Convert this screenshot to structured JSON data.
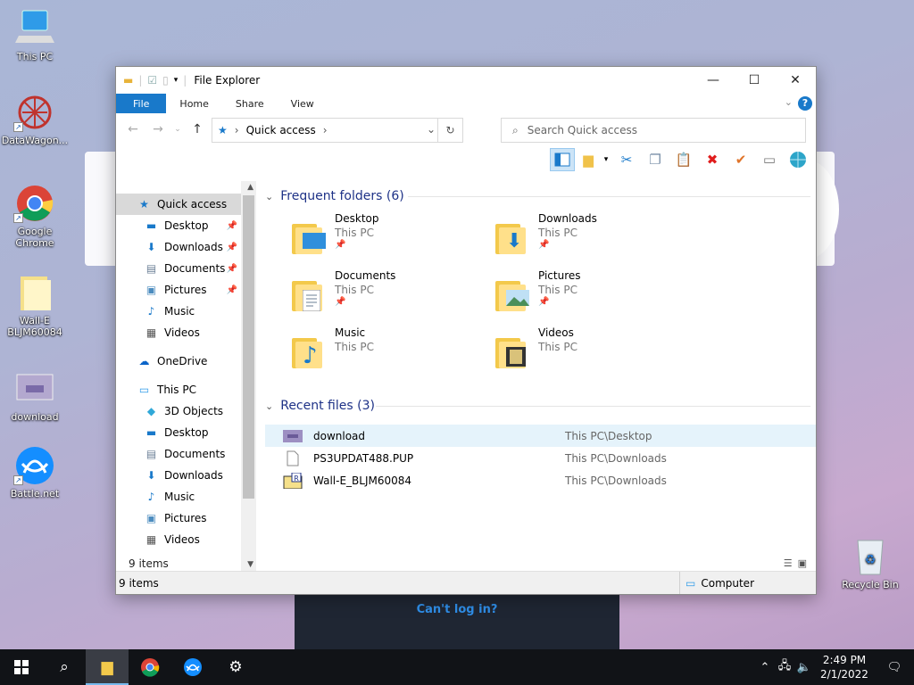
{
  "desktop": {
    "icons": [
      {
        "label": "This PC"
      },
      {
        "label": "DataWagon..."
      },
      {
        "label": "Google Chrome"
      },
      {
        "label": "Wall-E BLJM60084"
      },
      {
        "label": "download"
      },
      {
        "label": "Battle.net"
      },
      {
        "label": "Recycle Bin"
      }
    ],
    "background_link": "Can't log in?"
  },
  "window": {
    "title": "File Explorer",
    "ribbon_tabs": [
      "File",
      "Home",
      "Share",
      "View"
    ],
    "address": "Quick access",
    "search_placeholder": "Search Quick access",
    "nav": {
      "quick_access": "Quick access",
      "qa_items": [
        "Desktop",
        "Downloads",
        "Documents",
        "Pictures",
        "Music",
        "Videos"
      ],
      "onedrive": "OneDrive",
      "this_pc": "This PC",
      "pc_items": [
        "3D Objects",
        "Desktop",
        "Documents",
        "Downloads",
        "Music",
        "Pictures",
        "Videos"
      ]
    },
    "frequent_header": "Frequent folders (6)",
    "frequent": [
      {
        "name": "Desktop",
        "loc": "This PC"
      },
      {
        "name": "Downloads",
        "loc": "This PC"
      },
      {
        "name": "Documents",
        "loc": "This PC"
      },
      {
        "name": "Pictures",
        "loc": "This PC"
      },
      {
        "name": "Music",
        "loc": "This PC"
      },
      {
        "name": "Videos",
        "loc": "This PC"
      }
    ],
    "recent_header": "Recent files (3)",
    "recent": [
      {
        "name": "download",
        "path": "This PC\\Desktop"
      },
      {
        "name": "PS3UPDAT488.PUP",
        "path": "This PC\\Downloads"
      },
      {
        "name": "Wall-E_BLJM60084",
        "path": "This PC\\Downloads"
      }
    ],
    "item_count": "9 items",
    "status_count": "9 items",
    "status_location": "Computer"
  },
  "taskbar": {
    "time": "2:49 PM",
    "date": "2/1/2022"
  },
  "colors": {
    "accent": "#1979ca",
    "section_header": "#1e3287",
    "taskbar": "#111317"
  }
}
